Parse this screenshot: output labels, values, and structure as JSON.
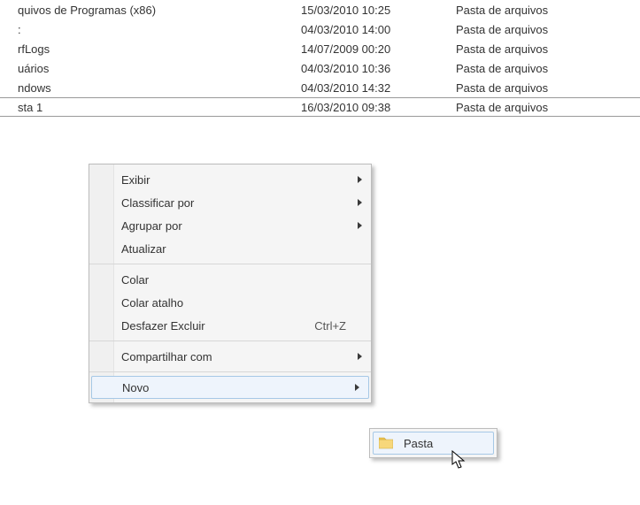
{
  "files": [
    {
      "name": "quivos de Programas (x86)",
      "date": "15/03/2010 10:25",
      "type": "Pasta de arquivos"
    },
    {
      "name": ":",
      "date": "04/03/2010 14:00",
      "type": "Pasta de arquivos"
    },
    {
      "name": "rfLogs",
      "date": "14/07/2009 00:20",
      "type": "Pasta de arquivos"
    },
    {
      "name": "uários",
      "date": "04/03/2010 10:36",
      "type": "Pasta de arquivos"
    },
    {
      "name": "ndows",
      "date": "04/03/2010 14:32",
      "type": "Pasta de arquivos"
    },
    {
      "name": "sta 1",
      "date": "16/03/2010 09:38",
      "type": "Pasta de arquivos"
    }
  ],
  "context_menu": {
    "sections": [
      [
        {
          "label": "Exibir",
          "submenu": true
        },
        {
          "label": "Classificar por",
          "submenu": true
        },
        {
          "label": "Agrupar por",
          "submenu": true
        },
        {
          "label": "Atualizar"
        }
      ],
      [
        {
          "label": "Colar"
        },
        {
          "label": "Colar atalho"
        },
        {
          "label": "Desfazer Excluir",
          "shortcut": "Ctrl+Z"
        }
      ],
      [
        {
          "label": "Compartilhar com",
          "submenu": true
        }
      ],
      [
        {
          "label": "Novo",
          "submenu": true,
          "highlight": true
        }
      ]
    ],
    "submenu_novo": {
      "item": "Pasta"
    }
  }
}
